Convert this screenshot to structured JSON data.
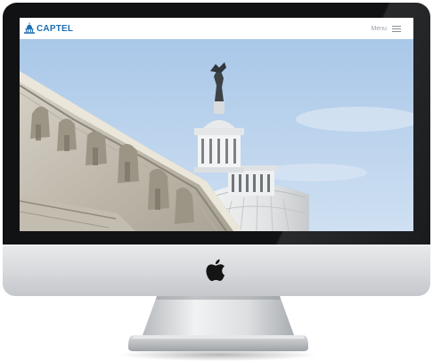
{
  "site": {
    "logo_text": "CAPTEL",
    "menu_label": "Menu"
  },
  "icons": {
    "logo": "capitol-dome-logo-icon",
    "menu": "hamburger-menu-icon",
    "device": "apple-logo-icon"
  },
  "colors": {
    "brand_blue": "#1f6fb3",
    "sky": "#b8d3ee",
    "bezel": "#111214"
  }
}
